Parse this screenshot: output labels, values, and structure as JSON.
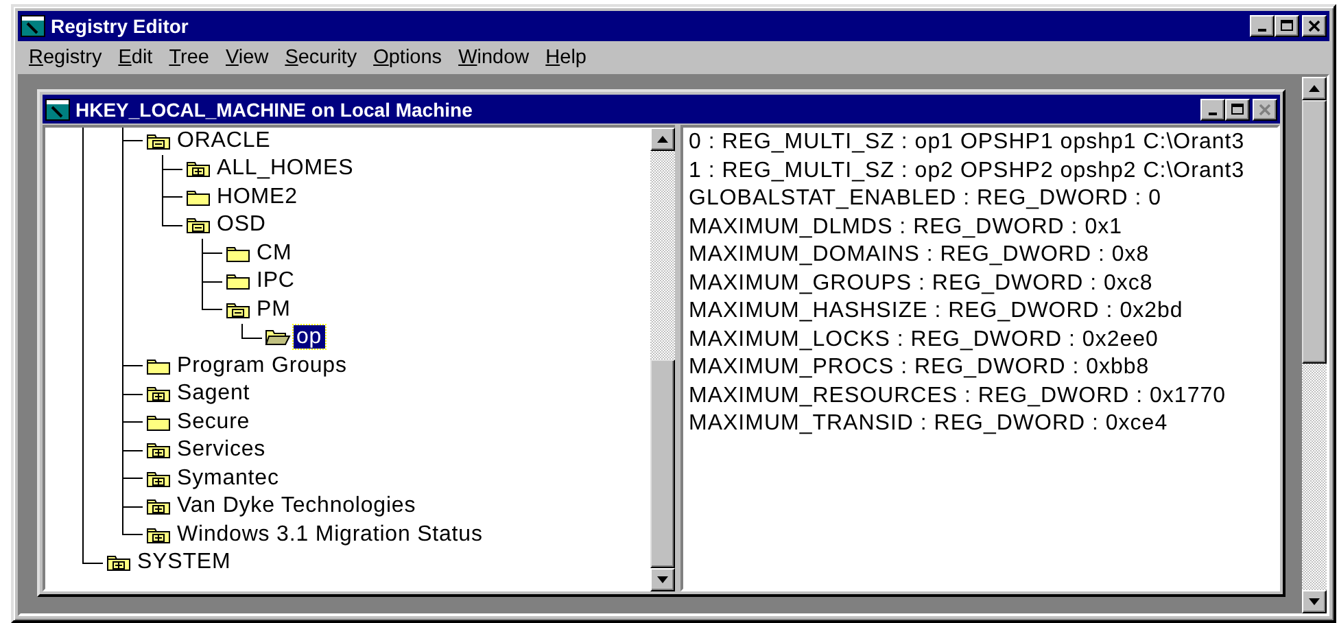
{
  "window": {
    "title": "Registry Editor"
  },
  "menu": [
    "Registry",
    "Edit",
    "Tree",
    "View",
    "Security",
    "Options",
    "Window",
    "Help"
  ],
  "child_window": {
    "title": "HKEY_LOCAL_MACHINE on Local Machine",
    "close_disabled": true
  },
  "tree": [
    {
      "children": [
        {
          "label": "ORACLE",
          "has_children": true,
          "expanded": true,
          "selected": false,
          "children": [
            {
              "label": "ALL_HOMES",
              "has_children": true,
              "expanded": false,
              "selected": false
            },
            {
              "label": "HOME2",
              "has_children": false,
              "expanded": false,
              "selected": false
            },
            {
              "label": "OSD",
              "has_children": true,
              "expanded": true,
              "selected": false,
              "children": [
                {
                  "label": "CM",
                  "has_children": false,
                  "expanded": false,
                  "selected": false
                },
                {
                  "label": "IPC",
                  "has_children": false,
                  "expanded": false,
                  "selected": false
                },
                {
                  "label": "PM",
                  "has_children": true,
                  "expanded": true,
                  "selected": false,
                  "children": [
                    {
                      "label": "op",
                      "has_children": false,
                      "expanded": false,
                      "selected": true
                    }
                  ]
                }
              ]
            }
          ]
        },
        {
          "label": "Program Groups",
          "has_children": false,
          "expanded": false,
          "selected": false
        },
        {
          "label": "Sagent",
          "has_children": true,
          "expanded": false,
          "selected": false
        },
        {
          "label": "Secure",
          "has_children": false,
          "expanded": false,
          "selected": false
        },
        {
          "label": "Services",
          "has_children": true,
          "expanded": false,
          "selected": false
        },
        {
          "label": "Symantec",
          "has_children": true,
          "expanded": false,
          "selected": false
        },
        {
          "label": "Van Dyke Technologies",
          "has_children": true,
          "expanded": false,
          "selected": false
        },
        {
          "label": "Windows 3.1 Migration Status",
          "has_children": true,
          "expanded": false,
          "selected": false
        }
      ]
    },
    {
      "label": "SYSTEM",
      "has_children": true,
      "expanded": false,
      "selected": false
    }
  ],
  "values": [
    "0 : REG_MULTI_SZ : op1 OPSHP1 opshp1 C:\\Orant3",
    "1 : REG_MULTI_SZ : op2 OPSHP2 opshp2 C:\\Orant3",
    "GLOBALSTAT_ENABLED : REG_DWORD : 0",
    "MAXIMUM_DLMDS : REG_DWORD : 0x1",
    "MAXIMUM_DOMAINS : REG_DWORD : 0x8",
    "MAXIMUM_GROUPS : REG_DWORD : 0xc8",
    "MAXIMUM_HASHSIZE : REG_DWORD : 0x2bd",
    "MAXIMUM_LOCKS : REG_DWORD : 0x2ee0",
    "MAXIMUM_PROCS : REG_DWORD : 0xbb8",
    "MAXIMUM_RESOURCES : REG_DWORD : 0x1770",
    "MAXIMUM_TRANSID : REG_DWORD : 0xce4"
  ]
}
